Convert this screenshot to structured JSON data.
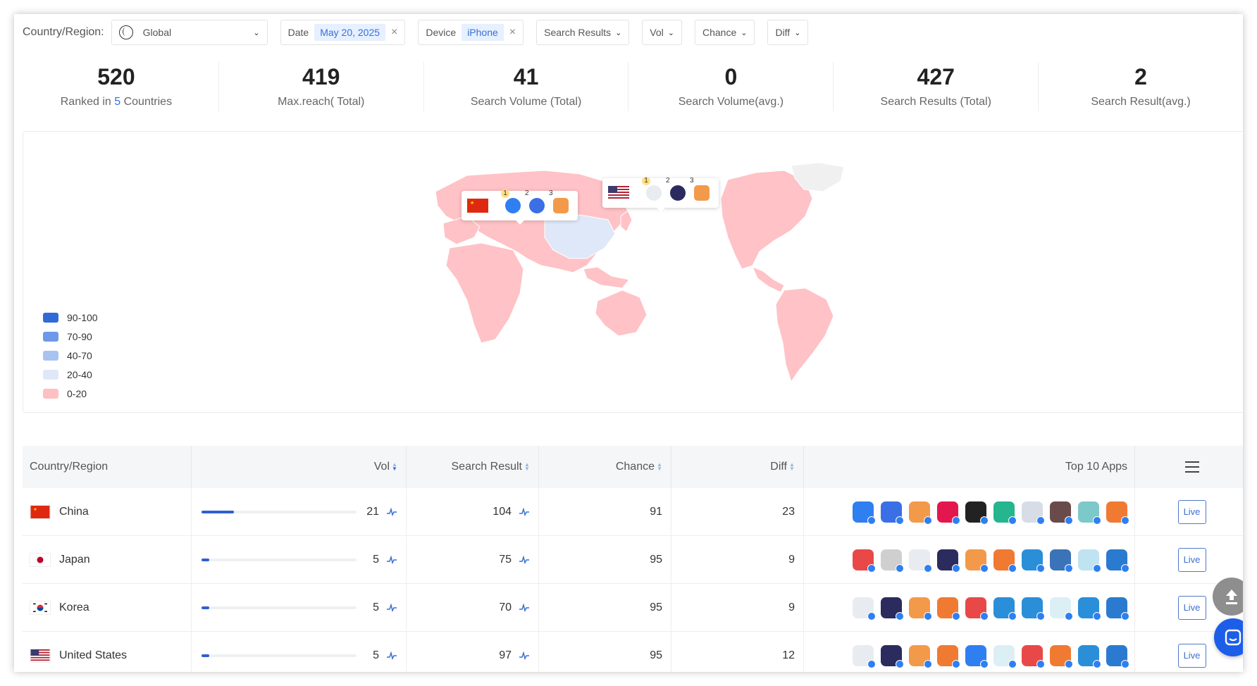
{
  "filters": {
    "country_label": "Country/Region:",
    "country_value": "Global",
    "date_label": "Date",
    "date_value": "May 20, 2025",
    "device_label": "Device",
    "device_value": "iPhone",
    "search_results_label": "Search Results",
    "vol_label": "Vol",
    "chance_label": "Chance",
    "diff_label": "Diff"
  },
  "stats": [
    {
      "value": "520",
      "label_pre": "Ranked in ",
      "label_hl": "5",
      "label_post": " Countries"
    },
    {
      "value": "419",
      "label": "Max.reach( Total)"
    },
    {
      "value": "41",
      "label": "Search Volume  (Total)"
    },
    {
      "value": "0",
      "label": "Search Volume(avg.)"
    },
    {
      "value": "427",
      "label": "Search Results  (Total)"
    },
    {
      "value": "2",
      "label": "Search Result(avg.)"
    }
  ],
  "legend": [
    {
      "label": "90-100",
      "color": "#2f6bd6"
    },
    {
      "label": "70-90",
      "color": "#6f98e8"
    },
    {
      "label": "40-70",
      "color": "#a9c3f1"
    },
    {
      "label": "20-40",
      "color": "#dfe8f9"
    },
    {
      "label": "0-20",
      "color": "#ffbfc3"
    }
  ],
  "popups": [
    {
      "country": "China",
      "ranks": [
        "1",
        "2",
        "3"
      ]
    },
    {
      "country": "United States",
      "ranks": [
        "1",
        "2",
        "3"
      ]
    }
  ],
  "table": {
    "headers": {
      "country": "Country/Region",
      "vol": "Vol",
      "search_result": "Search Result",
      "chance": "Chance",
      "diff": "Diff",
      "top_apps": "Top 10 Apps"
    },
    "live_label": "Live",
    "rows": [
      {
        "country": "China",
        "flag": "cn",
        "vol": "21",
        "vol_fraction": 0.21,
        "search_result": "104",
        "chance": "91",
        "diff": "23",
        "apps": [
          "#2f7ff0",
          "#3b6fe6",
          "#f29a4a",
          "#e3174d",
          "#222222",
          "#25b58f",
          "#d7dde6",
          "#6a4b4b",
          "#7dc8c8",
          "#f07a32"
        ]
      },
      {
        "country": "Japan",
        "flag": "jp",
        "vol": "5",
        "vol_fraction": 0.05,
        "search_result": "75",
        "chance": "95",
        "diff": "9",
        "apps": [
          "#e94848",
          "#cfcfcf",
          "#e8ebef",
          "#2b2b5e",
          "#f29a4a",
          "#f07a32",
          "#2a8fd8",
          "#3a73b8",
          "#bfe3f0",
          "#2a7ad0"
        ]
      },
      {
        "country": "Korea",
        "flag": "kr",
        "vol": "5",
        "vol_fraction": 0.05,
        "search_result": "70",
        "chance": "95",
        "diff": "9",
        "apps": [
          "#e8ebef",
          "#2b2b5e",
          "#f29a4a",
          "#f07a32",
          "#e94848",
          "#2a8fd8",
          "#2a8fd8",
          "#dbeff5",
          "#2a8fd8",
          "#2a7ad0"
        ]
      },
      {
        "country": "United States",
        "flag": "us",
        "vol": "5",
        "vol_fraction": 0.05,
        "search_result": "97",
        "chance": "95",
        "diff": "12",
        "apps": [
          "#e8ebef",
          "#2b2b5e",
          "#f29a4a",
          "#f07a32",
          "#2f7ff0",
          "#dbeff5",
          "#e94848",
          "#f07a32",
          "#2a8fd8",
          "#2a7ad0"
        ]
      }
    ]
  }
}
